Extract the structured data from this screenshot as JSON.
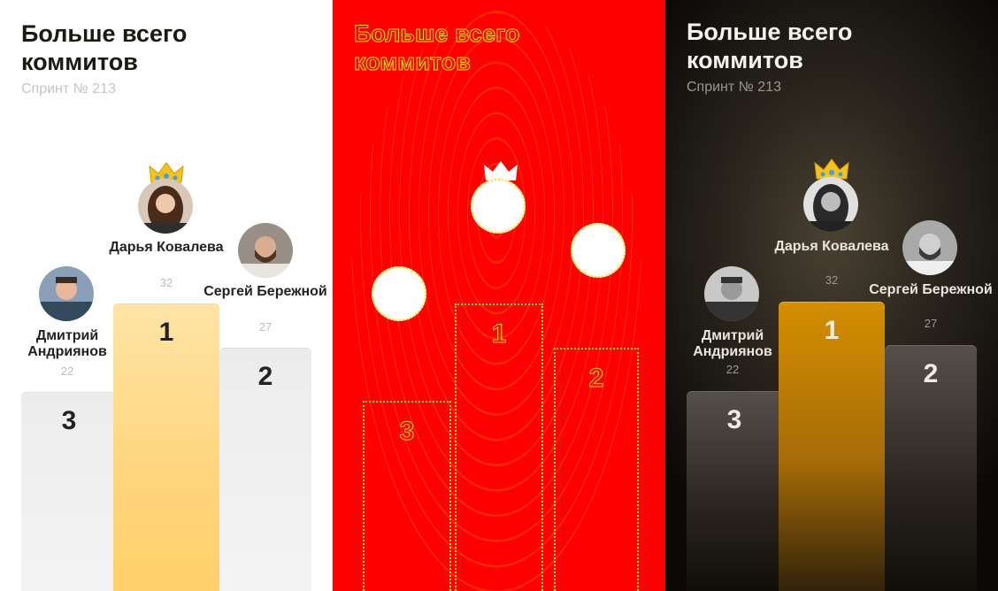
{
  "title": "Больше всего коммитов",
  "subtitle": "Спринт № 213",
  "podium": [
    {
      "place": "1",
      "name": "Дарья Ковалева",
      "score": "32",
      "crown": true,
      "avatar_icon": "woman-avatar-icon"
    },
    {
      "place": "2",
      "name": "Сергей Бережной",
      "score": "27",
      "crown": false,
      "avatar_icon": "bearded-man-avatar-icon"
    },
    {
      "place": "3",
      "name": "Дмитрий Андриянов",
      "score": "22",
      "crown": false,
      "avatar_icon": "man-avatar-icon"
    }
  ],
  "colors": {
    "light_bg": "#ffffff",
    "diff_bg": "#ff0000",
    "diff_stroke": "#ffe600",
    "dark_bg": "#0b0a08",
    "gold_light": "#ffd57c",
    "gold_dark": "#d48f00"
  }
}
